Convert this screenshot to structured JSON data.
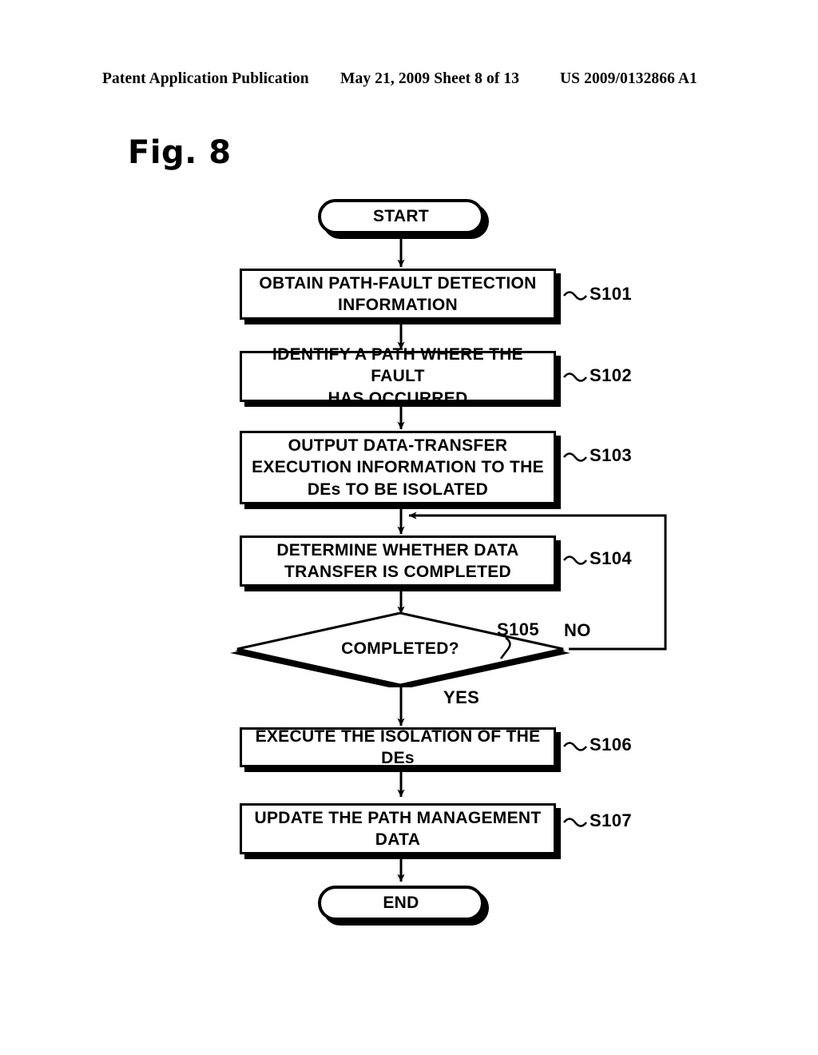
{
  "header": {
    "publication": "Patent Application Publication",
    "date_sheet": "May 21, 2009  Sheet 8 of 13",
    "patent_number": "US 2009/0132866 A1"
  },
  "figure": {
    "title": "Fig. 8"
  },
  "flowchart": {
    "start_label": "START",
    "end_label": "END",
    "decision": {
      "label": "COMPLETED?",
      "step": "S105",
      "yes_label": "YES",
      "no_label": "NO"
    },
    "steps": [
      {
        "id": "s101",
        "step": "S101",
        "lines": [
          "OBTAIN PATH-FAULT DETECTION",
          "INFORMATION"
        ],
        "text": "OBTAIN PATH-FAULT DETECTION INFORMATION"
      },
      {
        "id": "s102",
        "step": "S102",
        "lines": [
          "IDENTIFY A PATH WHERE THE FAULT",
          "HAS OCCURRED"
        ],
        "text": "IDENTIFY A PATH WHERE THE FAULT HAS OCCURRED"
      },
      {
        "id": "s103",
        "step": "S103",
        "lines": [
          "OUTPUT DATA-TRANSFER",
          "EXECUTION INFORMATION TO THE",
          "DEs TO BE ISOLATED"
        ],
        "text": "OUTPUT DATA-TRANSFER EXECUTION INFORMATION TO THE DEs TO BE ISOLATED"
      },
      {
        "id": "s104",
        "step": "S104",
        "lines": [
          "DETERMINE WHETHER DATA",
          "TRANSFER IS COMPLETED"
        ],
        "text": "DETERMINE WHETHER DATA TRANSFER IS COMPLETED"
      },
      {
        "id": "s106",
        "step": "S106",
        "lines": [
          "EXECUTE THE ISOLATION OF THE DEs"
        ],
        "text": "EXECUTE THE ISOLATION OF THE DEs"
      },
      {
        "id": "s107",
        "step": "S107",
        "lines": [
          "UPDATE THE PATH MANAGEMENT",
          "DATA"
        ],
        "text": "UPDATE THE PATH MANAGEMENT DATA"
      }
    ]
  },
  "colors": {
    "ink": "#000000",
    "paper": "#ffffff"
  }
}
